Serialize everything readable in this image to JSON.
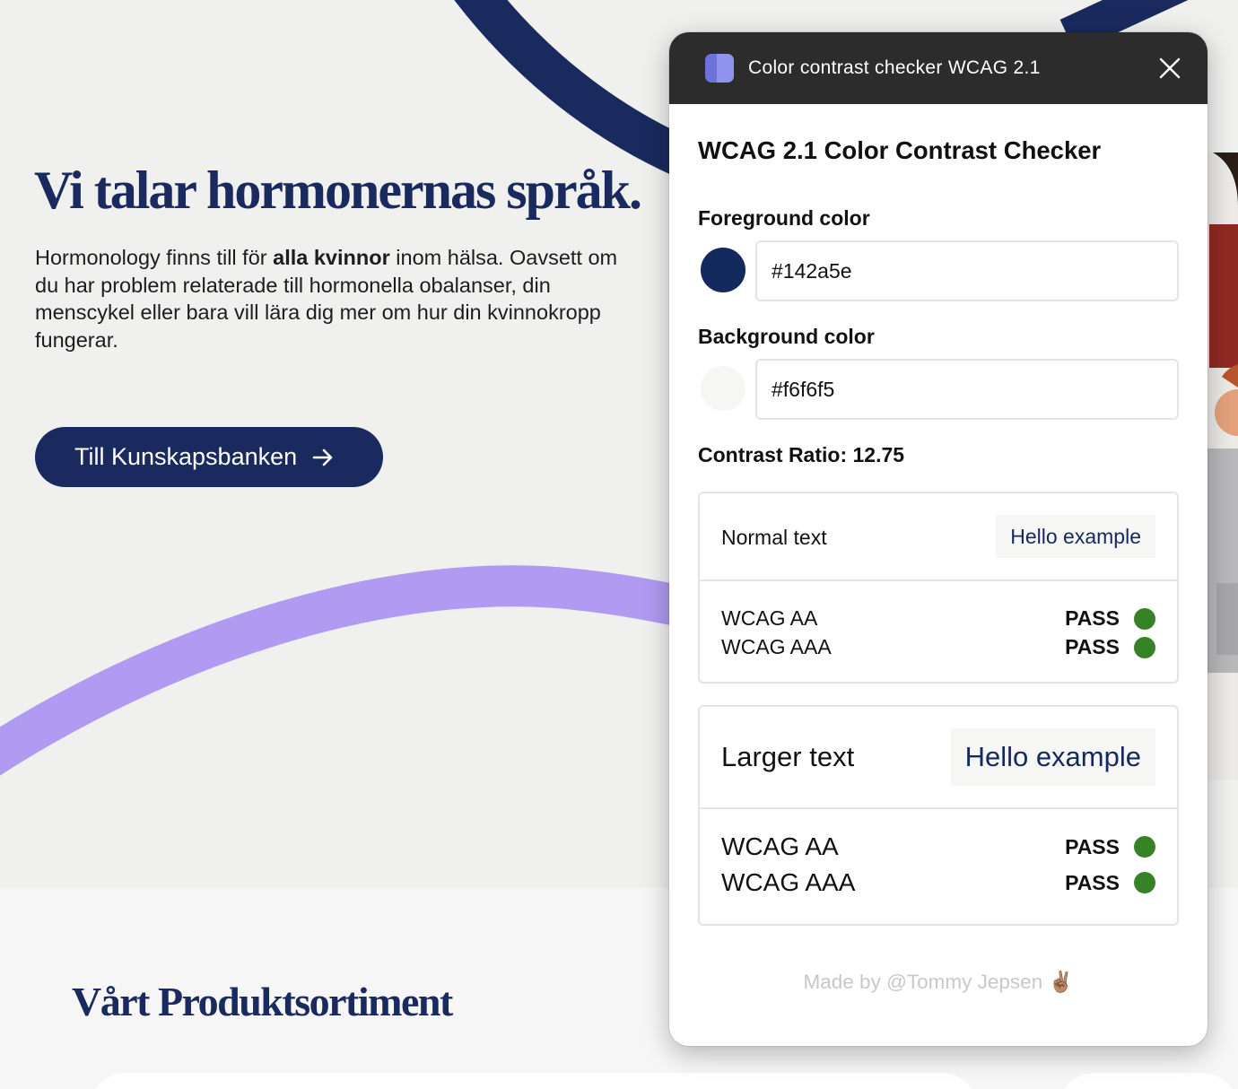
{
  "site": {
    "hero_title": "Vi talar hormonernas språk.",
    "hero_text_before": "Hormonology finns till för ",
    "hero_text_bold": "alla kvinnor",
    "hero_text_after": " inom hälsa. Oavsett om du har problem relaterade till hormonella obalanser, din menscykel eller bara vill lära dig mer om hur din kvinnokropp fungerar.",
    "cta_label": "Till Kunskapsbanken",
    "products_title": "Vårt Produktsortiment",
    "colors": {
      "navy": "#1a2a5e",
      "lavender": "#b09af2",
      "hero_bg": "#f0f0ef"
    }
  },
  "popup": {
    "window_title": "Color contrast checker WCAG 2.1",
    "heading": "WCAG 2.1 Color Contrast Checker",
    "foreground": {
      "label": "Foreground color",
      "value": "#142a5e"
    },
    "background": {
      "label": "Background color",
      "value": "#f6f6f5"
    },
    "contrast_ratio": "Contrast Ratio: 12.75",
    "normal": {
      "label": "Normal text",
      "sample": "Hello example",
      "results": [
        {
          "level": "WCAG AA",
          "status": "PASS"
        },
        {
          "level": "WCAG AAA",
          "status": "PASS"
        }
      ]
    },
    "larger": {
      "label": "Larger text",
      "sample": "Hello example",
      "results": [
        {
          "level": "WCAG AA",
          "status": "PASS"
        },
        {
          "level": "WCAG AAA",
          "status": "PASS"
        }
      ]
    },
    "footer": "Made by @Tommy Jepsen ✌🏽",
    "colors": {
      "pass": "#368227",
      "titlebar": "#2c2c2c"
    }
  }
}
